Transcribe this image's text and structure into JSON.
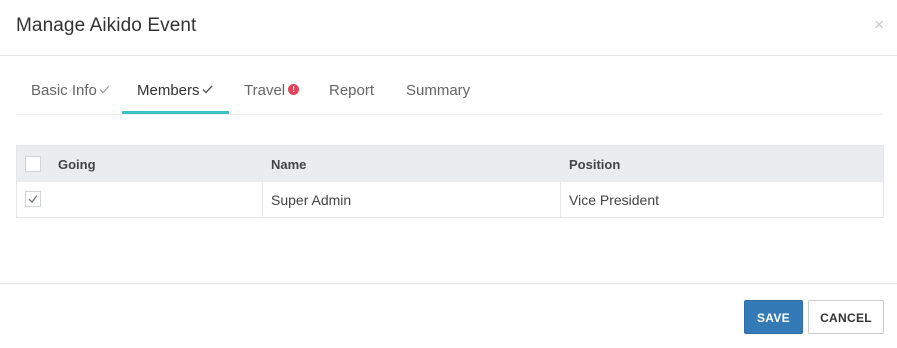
{
  "modal": {
    "title": "Manage Aikido Event",
    "close_symbol": "×"
  },
  "tabs": [
    {
      "label": "Basic Info",
      "status": "check",
      "active": false
    },
    {
      "label": "Members",
      "status": "check",
      "active": true
    },
    {
      "label": "Travel",
      "status": "alert",
      "active": false
    },
    {
      "label": "Report",
      "status": "",
      "active": false
    },
    {
      "label": "Summary",
      "status": "",
      "active": false
    }
  ],
  "table": {
    "columns": [
      "Going",
      "Name",
      "Position"
    ],
    "rows": [
      {
        "going": true,
        "name": "Super Admin",
        "position": "Vice President"
      }
    ],
    "select_all_checked": false
  },
  "footer": {
    "save_label": "SAVE",
    "cancel_label": "CANCEL"
  },
  "colors": {
    "accent": "#3cc2c2",
    "primary": "#337ab7",
    "alert": "#e0455b"
  },
  "icons": {
    "tab_check": "check-icon",
    "tab_alert": "alert-icon",
    "close": "close-icon"
  }
}
